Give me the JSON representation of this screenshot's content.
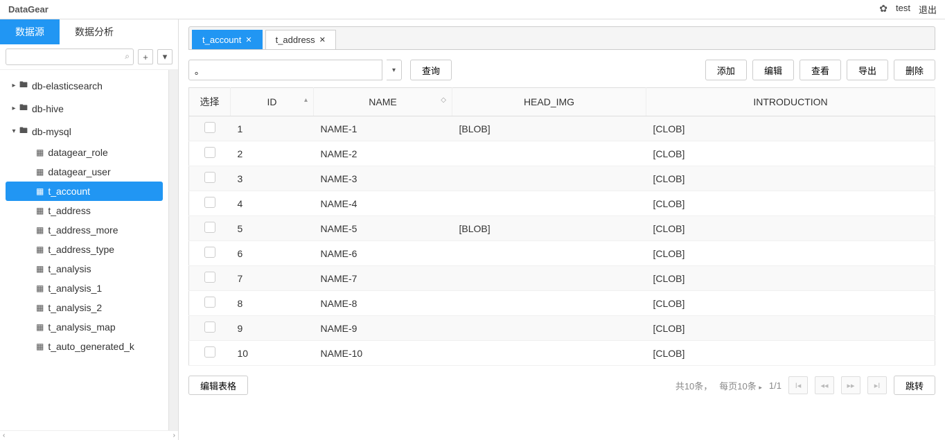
{
  "header": {
    "app_name": "DataGear",
    "username": "test",
    "logout": "退出"
  },
  "nav": {
    "tab_datasource": "数据源",
    "tab_analysis": "数据分析",
    "search_placeholder": ""
  },
  "tree": [
    {
      "label": "db-elasticsearch",
      "level": 0,
      "expanded": false
    },
    {
      "label": "db-hive",
      "level": 0,
      "expanded": false
    },
    {
      "label": "db-mysql",
      "level": 0,
      "expanded": true
    },
    {
      "label": "datagear_role",
      "level": 1
    },
    {
      "label": "datagear_user",
      "level": 1
    },
    {
      "label": "t_account",
      "level": 1,
      "selected": true
    },
    {
      "label": "t_address",
      "level": 1
    },
    {
      "label": "t_address_more",
      "level": 1
    },
    {
      "label": "t_address_type",
      "level": 1
    },
    {
      "label": "t_analysis",
      "level": 1
    },
    {
      "label": "t_analysis_1",
      "level": 1
    },
    {
      "label": "t_analysis_2",
      "level": 1
    },
    {
      "label": "t_analysis_map",
      "level": 1
    },
    {
      "label": "t_auto_generated_k",
      "level": 1
    }
  ],
  "tabs": [
    {
      "label": "t_account",
      "active": true
    },
    {
      "label": "t_address",
      "active": false
    }
  ],
  "toolbar": {
    "query_value": "。",
    "query": "查询",
    "add": "添加",
    "edit": "编辑",
    "view": "查看",
    "export": "导出",
    "delete": "删除"
  },
  "columns": {
    "select": "选择",
    "id": "ID",
    "name": "NAME",
    "head_img": "HEAD_IMG",
    "introduction": "INTRODUCTION"
  },
  "rows": [
    {
      "id": "1",
      "name": "NAME-1",
      "head_img": "[BLOB]",
      "introduction": "[CLOB]"
    },
    {
      "id": "2",
      "name": "NAME-2",
      "head_img": "",
      "introduction": "[CLOB]"
    },
    {
      "id": "3",
      "name": "NAME-3",
      "head_img": "",
      "introduction": "[CLOB]"
    },
    {
      "id": "4",
      "name": "NAME-4",
      "head_img": "",
      "introduction": "[CLOB]"
    },
    {
      "id": "5",
      "name": "NAME-5",
      "head_img": "[BLOB]",
      "introduction": "[CLOB]"
    },
    {
      "id": "6",
      "name": "NAME-6",
      "head_img": "",
      "introduction": "[CLOB]"
    },
    {
      "id": "7",
      "name": "NAME-7",
      "head_img": "",
      "introduction": "[CLOB]"
    },
    {
      "id": "8",
      "name": "NAME-8",
      "head_img": "",
      "introduction": "[CLOB]"
    },
    {
      "id": "9",
      "name": "NAME-9",
      "head_img": "",
      "introduction": "[CLOB]"
    },
    {
      "id": "10",
      "name": "NAME-10",
      "head_img": "",
      "introduction": "[CLOB]"
    }
  ],
  "footer": {
    "edit_grid": "编辑表格",
    "total_label": "共10条，",
    "page_size_label": "每页10条",
    "page_current": "1/1",
    "jump": "跳转"
  }
}
